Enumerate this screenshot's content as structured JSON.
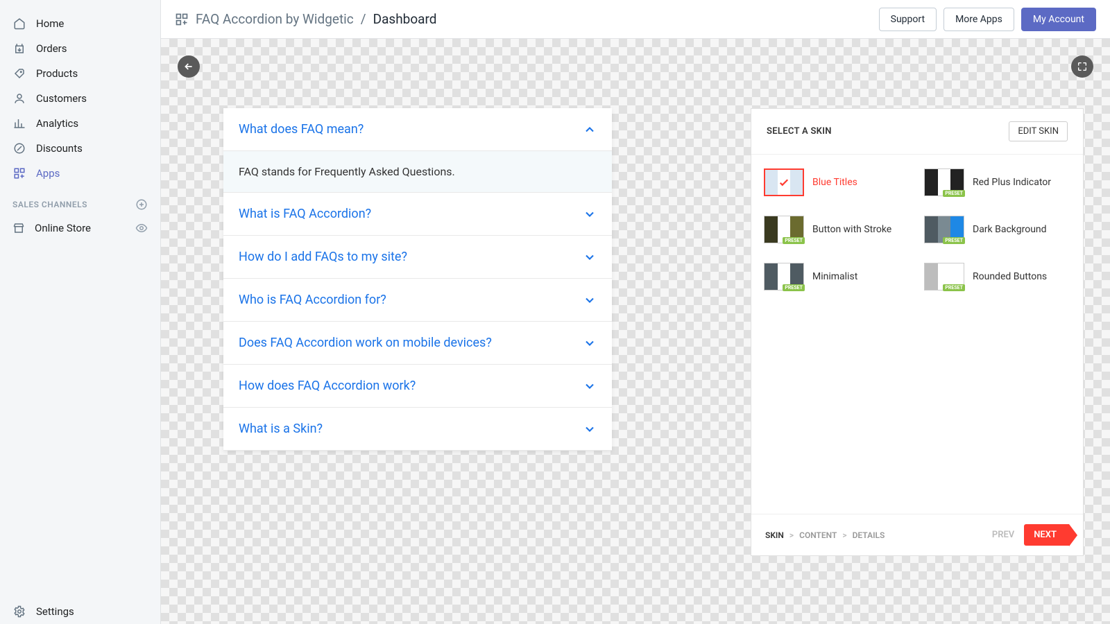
{
  "sidebar": {
    "items": [
      {
        "label": "Home"
      },
      {
        "label": "Orders"
      },
      {
        "label": "Products"
      },
      {
        "label": "Customers"
      },
      {
        "label": "Analytics"
      },
      {
        "label": "Discounts"
      },
      {
        "label": "Apps"
      }
    ],
    "sales_channels_header": "SALES CHANNELS",
    "online_store_label": "Online Store",
    "settings_label": "Settings"
  },
  "topbar": {
    "app_name": "FAQ Accordion by Widgetic",
    "separator": "/",
    "page": "Dashboard",
    "support": "Support",
    "more_apps": "More Apps",
    "my_account": "My Account"
  },
  "faq": {
    "items": [
      {
        "q": "What does FAQ mean?",
        "a": "FAQ stands for Frequently Asked Questions.",
        "expanded": true
      },
      {
        "q": "What is FAQ Accordion?",
        "expanded": false
      },
      {
        "q": "How do I add FAQs to my site?",
        "expanded": false
      },
      {
        "q": "Who is FAQ Accordion for?",
        "expanded": false
      },
      {
        "q": "Does FAQ Accordion work on mobile devices?",
        "expanded": false
      },
      {
        "q": "How does FAQ Accordion work?",
        "expanded": false
      },
      {
        "q": "What is a Skin?",
        "expanded": false
      }
    ]
  },
  "skin": {
    "header": "SELECT A SKIN",
    "edit_btn": "EDIT SKIN",
    "preset_badge": "PRESET",
    "options": [
      {
        "label": "Blue Titles",
        "selected": true
      },
      {
        "label": "Red Plus Indicator"
      },
      {
        "label": "Button with Stroke"
      },
      {
        "label": "Dark Background"
      },
      {
        "label": "Minimalist"
      },
      {
        "label": "Rounded Buttons"
      }
    ],
    "steps": {
      "skin": "SKIN",
      "content": "CONTENT",
      "details": "DETAILS",
      "sep": ">"
    },
    "prev": "PREV",
    "next": "NEXT"
  },
  "skin_thumbs": [
    [
      "#d9e6f2",
      "#ffffff",
      "#d9e6f2"
    ],
    [
      "#222222",
      "#ffffff",
      "#222222"
    ],
    [
      "#3a3a20",
      "#ffffff",
      "#6b6b2f"
    ],
    [
      "#4f5b62",
      "#7a8a92",
      "#1e88e5"
    ],
    [
      "#4f5b62",
      "#ffffff",
      "#4f5b62"
    ],
    [
      "#bdbdbd",
      "#ffffff",
      "#ffffff"
    ]
  ]
}
